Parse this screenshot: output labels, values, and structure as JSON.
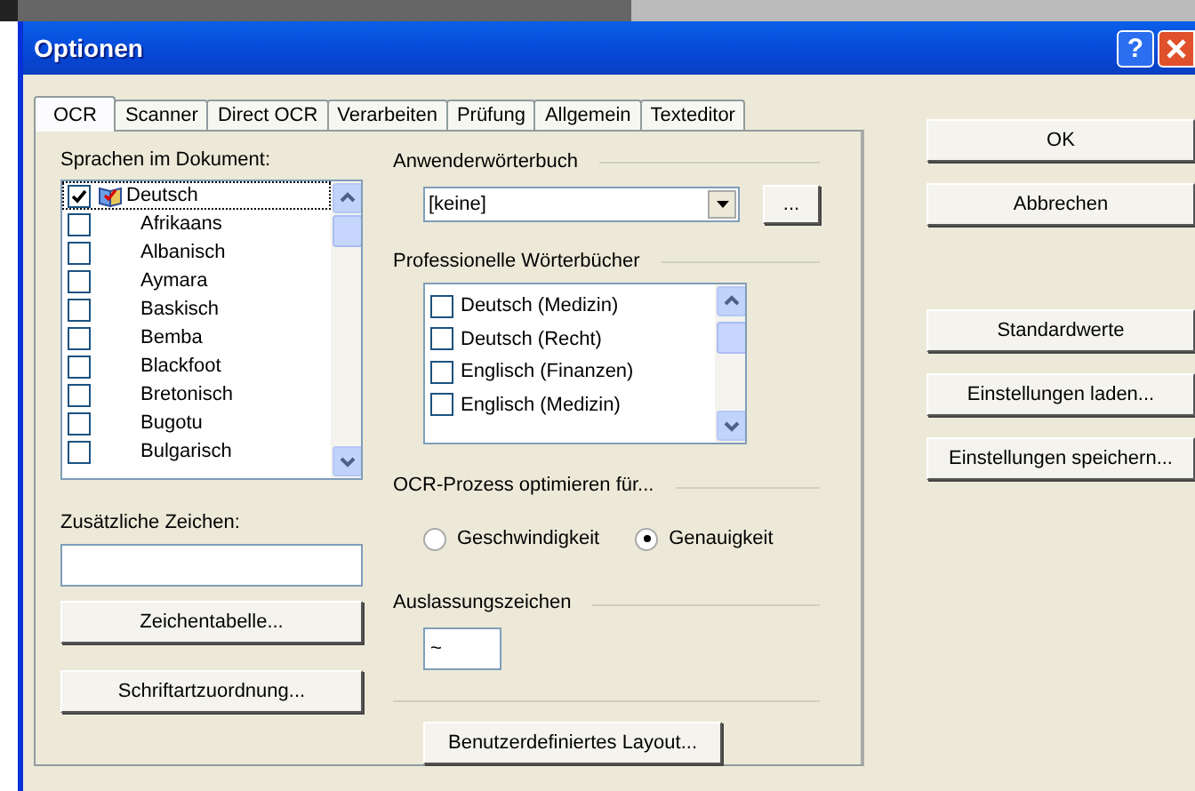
{
  "window": {
    "title": "Optionen",
    "help_button": "?"
  },
  "tabs": [
    {
      "label": "OCR",
      "selected": true
    },
    {
      "label": "Scanner",
      "selected": false
    },
    {
      "label": "Direct OCR",
      "selected": false
    },
    {
      "label": "Verarbeiten",
      "selected": false
    },
    {
      "label": "Prüfung",
      "selected": false
    },
    {
      "label": "Allgemein",
      "selected": false
    },
    {
      "label": "Texteditor",
      "selected": false
    }
  ],
  "languages": {
    "label": "Sprachen im Dokument:",
    "items": [
      {
        "name": "Deutsch",
        "checked": true,
        "selected": true
      },
      {
        "name": "Afrikaans",
        "checked": false,
        "selected": false
      },
      {
        "name": "Albanisch",
        "checked": false,
        "selected": false
      },
      {
        "name": "Aymara",
        "checked": false,
        "selected": false
      },
      {
        "name": "Baskisch",
        "checked": false,
        "selected": false
      },
      {
        "name": "Bemba",
        "checked": false,
        "selected": false
      },
      {
        "name": "Blackfoot",
        "checked": false,
        "selected": false
      },
      {
        "name": "Bretonisch",
        "checked": false,
        "selected": false
      },
      {
        "name": "Bugotu",
        "checked": false,
        "selected": false
      },
      {
        "name": "Bulgarisch",
        "checked": false,
        "selected": false
      }
    ]
  },
  "extra_characters": {
    "label": "Zusätzliche Zeichen:"
  },
  "character_table_button": "Zeichentabelle...",
  "font_mapping_button": "Schriftartzuordnung...",
  "user_dictionary": {
    "label": "Anwenderwörterbuch",
    "value": "[keine]",
    "browse_button": "..."
  },
  "professional_dictionaries": {
    "label": "Professionelle Wörterbücher",
    "items": [
      {
        "name": "Deutsch (Medizin)",
        "checked": false
      },
      {
        "name": "Deutsch (Recht)",
        "checked": false
      },
      {
        "name": "Englisch (Finanzen)",
        "checked": false
      },
      {
        "name": "Englisch (Medizin)",
        "checked": false
      }
    ]
  },
  "optimize": {
    "label": "OCR-Prozess optimieren für...",
    "options": [
      {
        "label": "Geschwindigkeit",
        "selected": false
      },
      {
        "label": "Genauigkeit",
        "selected": true
      }
    ]
  },
  "ellipsis_char": {
    "label": "Auslassungszeichen",
    "value": "~"
  },
  "custom_layout_button": "Benutzerdefiniertes Layout...",
  "main_buttons": [
    "OK",
    "Abbrechen"
  ],
  "settings_buttons": [
    "Standardwerte",
    "Einstellungen laden...",
    "Einstellungen speichern..."
  ]
}
